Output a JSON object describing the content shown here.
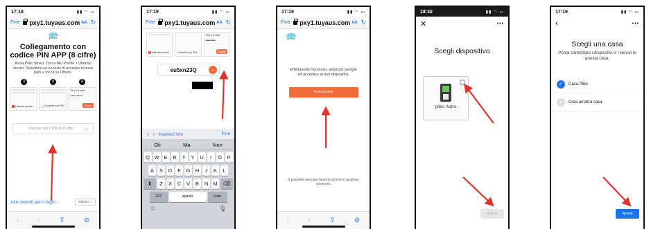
{
  "phones": [
    {
      "time": "17:18",
      "browser": {
        "done": "Fine",
        "url": "pxy1.tuyaus.com",
        "text_size": "AA",
        "reload": "↻"
      },
      "logo": "pliko",
      "title": "Collegamento con codice PIN APP (8 cifre)",
      "description": "Avvia Plikc Smart. Tocca Mio Profilo > Ulteriori servizi. Seleziona un servizio di accesso di terze parti e tocca su Ottieni.",
      "steps": [
        "1",
        "2",
        "3"
      ],
      "cards": {
        "card1_item": "Ulteriori servizi",
        "card2_item": "Connetti con PIN",
        "card3_title": "PIN a 8 cifre",
        "card3_pin": "••••••••",
        "card3_button": "Copia"
      },
      "pin_placeholder": "Inserisci qui il PIN di 8 cifre",
      "other_login": "Altri metodi per il login",
      "language": "Italiano"
    },
    {
      "time": "17:19",
      "browser": {
        "done": "Fine",
        "url": "pxy1.tuyaus.com",
        "text_size": "AA",
        "reload": "↻"
      },
      "cards": {
        "card1_item": "Ulteriori servizi",
        "card2_item": "Connetti con PIN",
        "card3_title": "PIN a 8 cifre",
        "card3_pin": "••••••••",
        "card3_button": "Copia"
      },
      "pin_value": "eu5xn23Q",
      "keyboard": {
        "accessory_info": "Inserisci info",
        "accessory_done": "Fine",
        "suggestions": [
          "Ok",
          "Ma",
          "Non"
        ],
        "row1": [
          "Q",
          "W",
          "E",
          "R",
          "T",
          "Y",
          "U",
          "I",
          "O",
          "P"
        ],
        "row2": [
          "A",
          "S",
          "D",
          "F",
          "G",
          "H",
          "J",
          "K",
          "L"
        ],
        "row3": [
          "Z",
          "X",
          "C",
          "V",
          "B",
          "N",
          "M"
        ],
        "numbers": "123",
        "space": "spazio",
        "return": "invio"
      }
    },
    {
      "time": "17:19",
      "browser": {
        "done": "Fine",
        "url": "pxy1.tuyaus.com",
        "text_size": "AA",
        "reload": "↻"
      },
      "logo": "pliko",
      "consent": "Effettuando l'accesso, autorizzi Google ad accedere ai tuoi dispositivi.",
      "authorize": "Autorizzare",
      "revoke": "È possibile revocare l'autorizzazione in qualsiasi momento."
    },
    {
      "time": "18:32",
      "title": "Scegli dispositivo",
      "device_name": "plikc Astro",
      "next": "Avanti"
    },
    {
      "time": "17:19",
      "title": "Scegli una casa",
      "subtitle": "Potrai controllare i dispositivi e i servizi in questa casa.",
      "homes": [
        "Casa Plikc",
        "Crea un'altra casa"
      ],
      "next": "Avanti"
    }
  ],
  "colors": {
    "accent_orange": "#f26b3a",
    "link_blue": "#1a73e8",
    "arrow_red": "#e0332b"
  }
}
